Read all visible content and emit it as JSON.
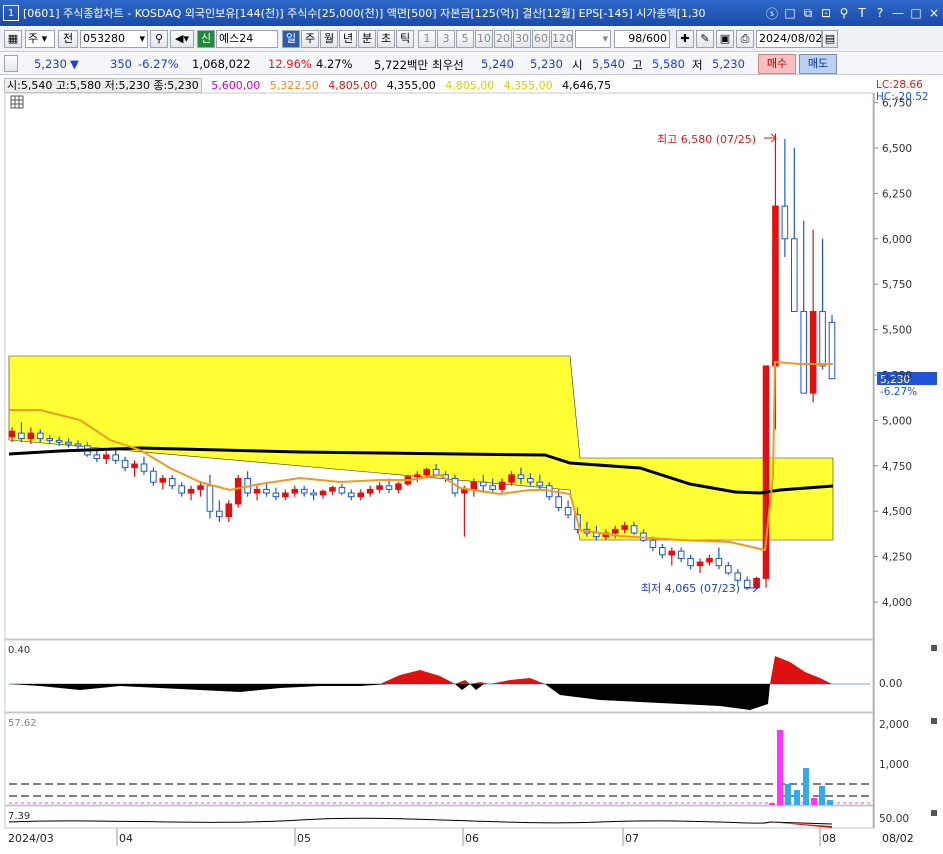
{
  "window": {
    "badge": "1",
    "title": "[0601] 주식종합차트 - KOSDAQ 외국인보유[144(천)] 주식수[25,000(천)] 액면[500] 자본금[125(억)] 결산[12월] EPS[-145] 시가총액[1,30",
    "icons": [
      "ⓢ",
      "□",
      "⧉",
      "⊡",
      "⚲",
      "T",
      "?",
      "—",
      "□",
      "×"
    ]
  },
  "toolbar": {
    "period_select": "주",
    "prev_label": "전",
    "code": "053280",
    "stock_name": "예스24",
    "market_badge": "신",
    "timeframes": [
      "일",
      "주",
      "월",
      "년",
      "분",
      "초",
      "틱"
    ],
    "intervals": [
      "1",
      "3",
      "5",
      "10",
      "20",
      "30",
      "60",
      "120"
    ],
    "count": "98/600",
    "date": "2024/08/02"
  },
  "quote": {
    "price": "5,230",
    "arrow": "▼",
    "change": "350",
    "change_pct": "-6.27%",
    "volume": "1,068,022",
    "turnover": "12.96%",
    "ratio": "4.27%",
    "amount": "5,722백만",
    "priority_label": "최우선",
    "bid": "5,240",
    "ask": "5,230",
    "open_label": "시",
    "open": "5,540",
    "high_label": "고",
    "high": "5,580",
    "low_label": "저",
    "low": "5,230",
    "buy_label": "매수",
    "sell_label": "매도"
  },
  "legend": {
    "ohlc": "시:5,540 고:5,580 저:5,230 종:5,230",
    "ma1": "5,600,00",
    "ma2": "5,322,50",
    "ma3": "4,805,00",
    "ma4": "4,355,00",
    "ma5": "4,805,00",
    "ma6": "4,355,00",
    "ma7": "4,646,75",
    "colors": {
      "ma1": "#cc00cc",
      "ma2": "#e8901a",
      "ma3": "#d81b1b",
      "ma4": "#000000",
      "ma5": "#e6c800",
      "ma6": "#e6c800",
      "ma7": "#000000"
    }
  },
  "price_axis": {
    "ticks": [
      "6,750",
      "6,500",
      "6,250",
      "6,000",
      "5,750",
      "5,500",
      "5,250",
      "5,000",
      "4,750",
      "4,500",
      "4,250",
      "4,000"
    ],
    "lc": "LC:28.66",
    "hc": "HC:-20.52",
    "current_price": "5,230",
    "current_pct": "-6.27%"
  },
  "annotations": {
    "high": "최고 6,580 (07/25)",
    "low": "최저 4,065 (07/23)"
  },
  "indicator1": {
    "label": "0.40",
    "axis": "0.00"
  },
  "indicator2": {
    "label": "57.62",
    "ticks": [
      "2,000",
      "1,000"
    ]
  },
  "indicator3": {
    "label": "7.39",
    "axis": "50.00"
  },
  "dates": [
    "2024/03",
    "04",
    "05",
    "06",
    "07",
    "08",
    "08/02"
  ],
  "candles": [
    [
      4910,
      4960,
      4880,
      4940
    ],
    [
      4930,
      4990,
      4880,
      4900
    ],
    [
      4900,
      4960,
      4870,
      4930
    ],
    [
      4930,
      4950,
      4880,
      4900
    ],
    [
      4900,
      4920,
      4870,
      4890
    ],
    [
      4890,
      4910,
      4860,
      4880
    ],
    [
      4880,
      4900,
      4850,
      4870
    ],
    [
      4870,
      4890,
      4840,
      4860
    ],
    [
      4860,
      4880,
      4800,
      4810
    ],
    [
      4810,
      4840,
      4770,
      4790
    ],
    [
      4790,
      4830,
      4760,
      4810
    ],
    [
      4810,
      4840,
      4760,
      4780
    ],
    [
      4780,
      4800,
      4720,
      4740
    ],
    [
      4740,
      4780,
      4690,
      4760
    ],
    [
      4760,
      4800,
      4700,
      4720
    ],
    [
      4720,
      4740,
      4640,
      4660
    ],
    [
      4660,
      4700,
      4620,
      4680
    ],
    [
      4680,
      4700,
      4620,
      4640
    ],
    [
      4640,
      4660,
      4580,
      4600
    ],
    [
      4600,
      4640,
      4560,
      4620
    ],
    [
      4620,
      4660,
      4580,
      4640
    ],
    [
      4640,
      4700,
      4460,
      4500
    ],
    [
      4500,
      4560,
      4440,
      4470
    ],
    [
      4470,
      4560,
      4440,
      4540
    ],
    [
      4540,
      4700,
      4520,
      4680
    ],
    [
      4680,
      4720,
      4580,
      4600
    ],
    [
      4600,
      4640,
      4560,
      4620
    ],
    [
      4620,
      4660,
      4580,
      4600
    ],
    [
      4600,
      4630,
      4560,
      4580
    ],
    [
      4580,
      4620,
      4560,
      4600
    ],
    [
      4600,
      4640,
      4580,
      4620
    ],
    [
      4620,
      4640,
      4580,
      4600
    ],
    [
      4600,
      4620,
      4560,
      4590
    ],
    [
      4590,
      4620,
      4570,
      4610
    ],
    [
      4610,
      4640,
      4590,
      4630
    ],
    [
      4630,
      4650,
      4590,
      4600
    ],
    [
      4600,
      4620,
      4560,
      4580
    ],
    [
      4580,
      4620,
      4560,
      4600
    ],
    [
      4600,
      4640,
      4580,
      4620
    ],
    [
      4620,
      4660,
      4600,
      4640
    ],
    [
      4640,
      4680,
      4600,
      4620
    ],
    [
      4620,
      4660,
      4600,
      4650
    ],
    [
      4650,
      4700,
      4640,
      4690
    ],
    [
      4690,
      4720,
      4660,
      4700
    ],
    [
      4700,
      4740,
      4680,
      4730
    ],
    [
      4730,
      4760,
      4690,
      4700
    ],
    [
      4700,
      4720,
      4660,
      4680
    ],
    [
      4680,
      4700,
      4580,
      4600
    ],
    [
      4600,
      4640,
      4360,
      4620
    ],
    [
      4620,
      4680,
      4580,
      4660
    ],
    [
      4660,
      4700,
      4600,
      4640
    ],
    [
      4640,
      4680,
      4600,
      4620
    ],
    [
      4620,
      4680,
      4600,
      4660
    ],
    [
      4660,
      4720,
      4640,
      4700
    ],
    [
      4700,
      4740,
      4650,
      4680
    ],
    [
      4680,
      4710,
      4640,
      4660
    ],
    [
      4660,
      4700,
      4620,
      4640
    ],
    [
      4640,
      4660,
      4560,
      4580
    ],
    [
      4580,
      4620,
      4500,
      4520
    ],
    [
      4520,
      4560,
      4460,
      4480
    ],
    [
      4480,
      4520,
      4380,
      4400
    ],
    [
      4400,
      4440,
      4360,
      4380
    ],
    [
      4380,
      4420,
      4340,
      4360
    ],
    [
      4360,
      4400,
      4340,
      4380
    ],
    [
      4380,
      4420,
      4350,
      4400
    ],
    [
      4400,
      4440,
      4380,
      4420
    ],
    [
      4420,
      4440,
      4370,
      4380
    ],
    [
      4380,
      4400,
      4330,
      4340
    ],
    [
      4340,
      4360,
      4280,
      4300
    ],
    [
      4300,
      4320,
      4240,
      4260
    ],
    [
      4260,
      4300,
      4200,
      4280
    ],
    [
      4280,
      4300,
      4220,
      4240
    ],
    [
      4240,
      4260,
      4180,
      4200
    ],
    [
      4200,
      4240,
      4160,
      4220
    ],
    [
      4220,
      4260,
      4200,
      4240
    ],
    [
      4240,
      4300,
      4180,
      4200
    ],
    [
      4200,
      4220,
      4150,
      4160
    ],
    [
      4160,
      4180,
      4100,
      4120
    ],
    [
      4120,
      4140,
      4065,
      4080
    ],
    [
      4080,
      4140,
      4070,
      4130
    ],
    [
      4130,
      5300,
      4080,
      5300
    ],
    [
      5300,
      6580,
      4950,
      6180
    ],
    [
      6180,
      6550,
      5900,
      6000
    ],
    [
      6000,
      6500,
      5700,
      5600
    ],
    [
      5600,
      6100,
      5200,
      5150
    ],
    [
      5150,
      6050,
      5100,
      5600
    ],
    [
      5600,
      6000,
      5280,
      5300
    ],
    [
      5540,
      5580,
      5230,
      5230
    ]
  ]
}
